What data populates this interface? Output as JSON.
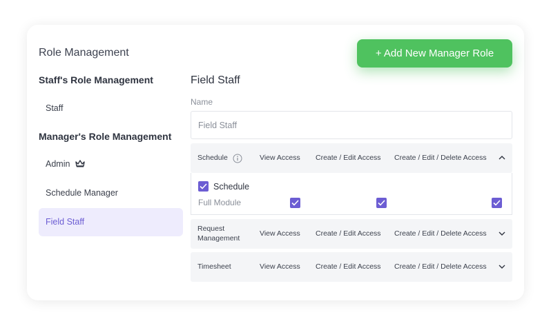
{
  "header": {
    "title": "Role Management",
    "add_button_label": "+ Add New Manager Role"
  },
  "sidebar": {
    "staff_heading": "Staff's Role Management",
    "staff_items": [
      {
        "label": "Staff"
      }
    ],
    "manager_heading": "Manager's Role Management",
    "manager_items": [
      {
        "label": "Admin",
        "icon": "crown-icon"
      },
      {
        "label": "Schedule Manager"
      },
      {
        "label": "Field Staff",
        "active": true
      }
    ]
  },
  "detail": {
    "title": "Field Staff",
    "name_label": "Name",
    "name_value": "Field Staff",
    "columns": [
      "View Access",
      "Create / Edit Access",
      "Create / Edit / Delete Access"
    ],
    "modules": [
      {
        "name": "Schedule",
        "has_info_icon": true,
        "expanded": true
      },
      {
        "name": "Request Management",
        "name_lines": [
          "Request",
          "Management"
        ],
        "expanded": false
      },
      {
        "name": "Timesheet",
        "expanded": false
      }
    ],
    "schedule_expanded": {
      "module_checkbox_label": "Schedule",
      "module_checked": true,
      "row_label": "Full Module",
      "view_checked": true,
      "create_edit_checked": true,
      "create_edit_delete_checked": true
    }
  },
  "colors": {
    "accent": "#6c5dd3",
    "button_green": "#4fc25f",
    "active_bg": "#eeecfd",
    "row_bg": "#f4f5f7"
  }
}
